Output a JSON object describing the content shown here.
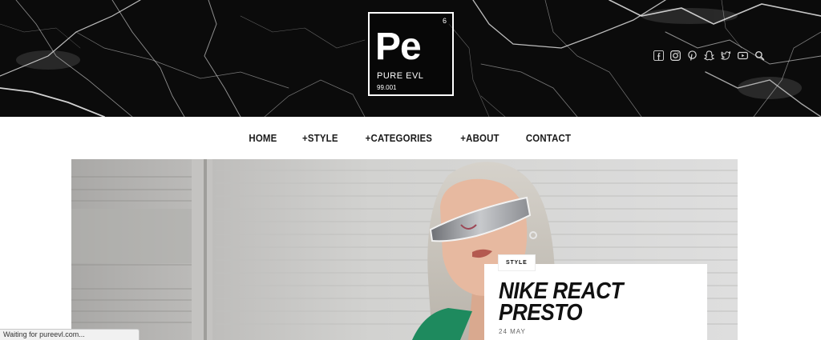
{
  "logo": {
    "atomic_number": "6",
    "symbol": "Pe",
    "name": "PURE EVL",
    "mass": "99.001"
  },
  "social": [
    {
      "name": "facebook-icon"
    },
    {
      "name": "instagram-icon"
    },
    {
      "name": "pinterest-icon"
    },
    {
      "name": "snapchat-icon"
    },
    {
      "name": "twitter-icon"
    },
    {
      "name": "youtube-icon"
    },
    {
      "name": "search-icon"
    }
  ],
  "nav": {
    "items": [
      "HOME",
      "+STYLE",
      "+CATEGORIES",
      "+ABOUT",
      "CONTACT"
    ]
  },
  "hero": {
    "category": "STYLE",
    "title": "NIKE REACT PRESTO",
    "date": "24 MAY"
  },
  "status_bar": {
    "text": "Waiting for pureevl.com..."
  },
  "colors": {
    "header_bg": "#0b0b0b",
    "nav_text": "#1b1b1b",
    "jacket_green": "#1e8a5e"
  }
}
